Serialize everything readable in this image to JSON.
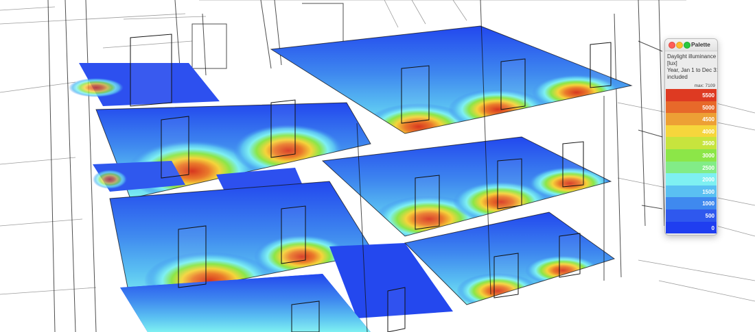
{
  "palette": {
    "title": "Palette",
    "description_lines": [
      "Daylight illuminance",
      "[lux]",
      "Year, Jan 1 to Dec 31",
      "included"
    ],
    "max_label": "max: 7109",
    "legend": [
      {
        "label": "5500",
        "color": "#de3a22"
      },
      {
        "label": "5000",
        "color": "#e7692a"
      },
      {
        "label": "4500",
        "color": "#eda035"
      },
      {
        "label": "4000",
        "color": "#f6d63c"
      },
      {
        "label": "3500",
        "color": "#c7e43d"
      },
      {
        "label": "3000",
        "color": "#8ce648"
      },
      {
        "label": "2500",
        "color": "#82ec87"
      },
      {
        "label": "2000",
        "color": "#7ef0f2"
      },
      {
        "label": "1500",
        "color": "#5ac0f2"
      },
      {
        "label": "1000",
        "color": "#3f89ef"
      },
      {
        "label": "500",
        "color": "#2f58ee"
      },
      {
        "label": "0",
        "color": "#1f3ef0"
      }
    ]
  }
}
